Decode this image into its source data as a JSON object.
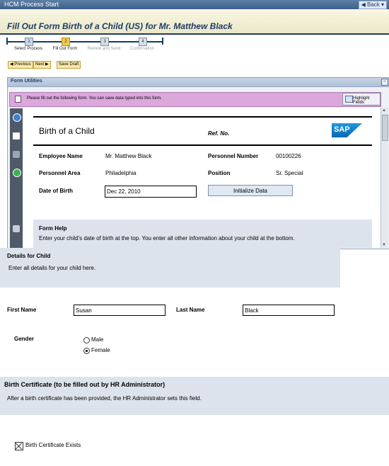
{
  "window": {
    "title": "HCM Process Start",
    "back_label": "Back"
  },
  "page": {
    "title": "Fill Out Form Birth of a Child (US) for Mr. Matthew Black"
  },
  "roadmap": {
    "steps": [
      {
        "num": "1",
        "label": "Select Process"
      },
      {
        "num": "2",
        "label": "Fill Out Form"
      },
      {
        "num": "3",
        "label": "Review and Send"
      },
      {
        "num": "4",
        "label": "Confirmation"
      }
    ]
  },
  "toolbar": {
    "previous": "Previous",
    "next": "Next",
    "save_draft": "Save Draft"
  },
  "form_utilities": {
    "title": "Form Utilities",
    "info_message": "Please fill out the following form. You can save data typed into this form.",
    "highlight_fields": "Highlight Fields"
  },
  "form": {
    "title": "Birth of a Child",
    "ref_no_label": "Ref. No.",
    "logo_text": "SAP",
    "employee_name_label": "Employee Name",
    "employee_name": "Mr. Matthew Black",
    "personnel_number_label": "Personnel Number",
    "personnel_number": "00100226",
    "personnel_area_label": "Personnel Area",
    "personnel_area": "Philadelphia",
    "position_label": "Position",
    "position": "Sr. Special",
    "date_of_birth_label": "Date of Birth",
    "date_of_birth": "Dec 22, 2010",
    "initialize_data": "Initialize Data",
    "help_title": "Form Help",
    "help_text": "Enter your child's date of birth at the top. You enter all other information about your child at the bottom."
  },
  "child_details": {
    "title": "Details for Child",
    "text": "Enter all details for your child here.",
    "first_name_label": "First Name",
    "first_name": "Susan",
    "last_name_label": "Last Name",
    "last_name": "Black",
    "gender_label": "Gender",
    "gender_options": [
      "Male",
      "Female"
    ],
    "gender_selected": "Female"
  },
  "birth_certificate": {
    "title": "Birth Certificate (to be filled out by HR Administrator)",
    "text": "After a birth certificate has been provided, the HR Administrator sets this field.",
    "checkbox_label": "Birth Certificate Exists"
  }
}
